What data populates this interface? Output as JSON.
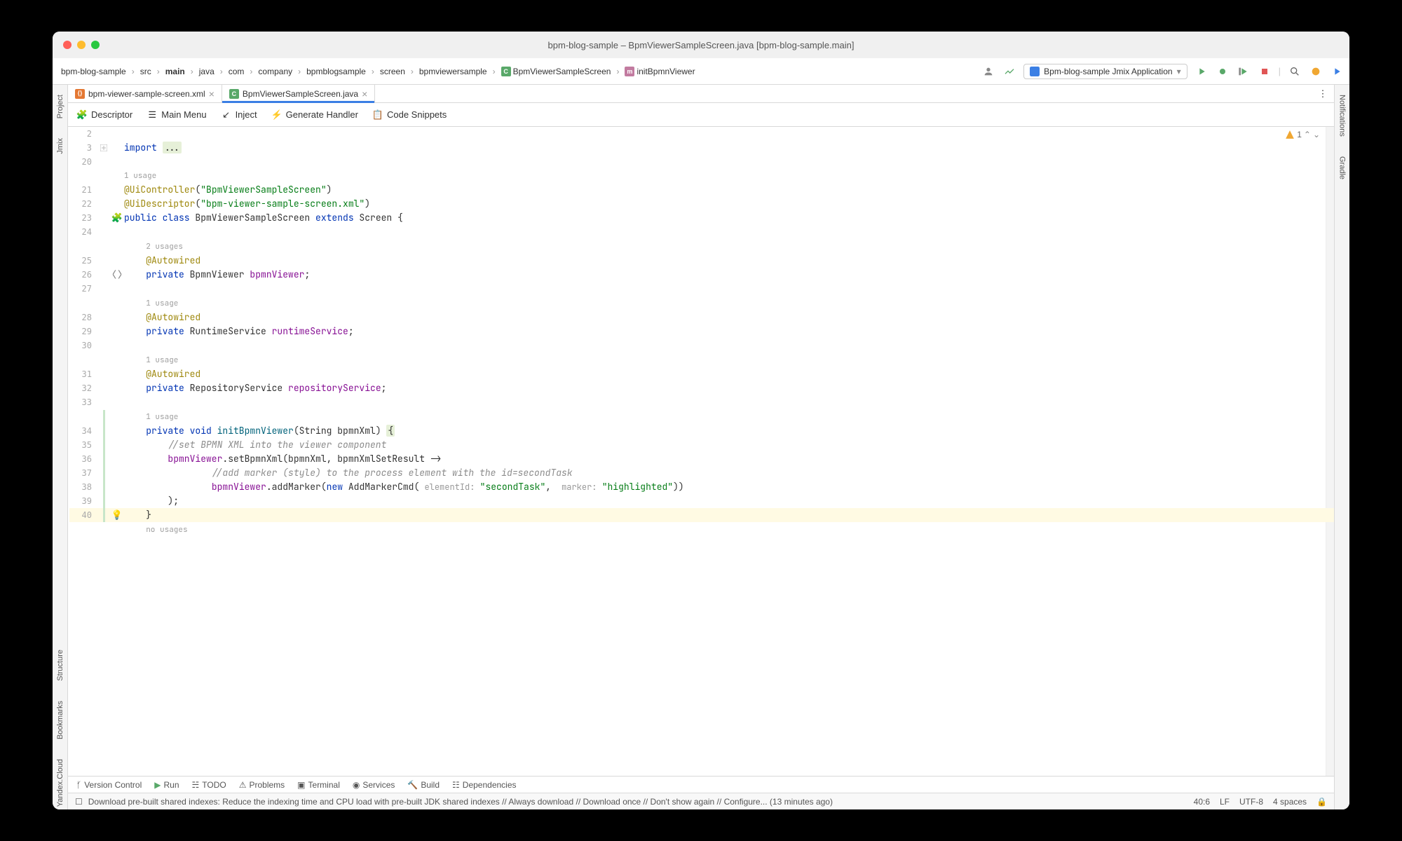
{
  "window_title": "bpm-blog-sample – BpmViewerSampleScreen.java [bpm-blog-sample.main]",
  "breadcrumb": {
    "items": [
      "bpm-blog-sample",
      "src",
      "main",
      "java",
      "com",
      "company",
      "bpmblogsample",
      "screen",
      "bpmviewersample",
      "BpmViewerSampleScreen",
      "initBpmnViewer"
    ]
  },
  "run_config": "Bpm-blog-sample Jmix Application",
  "tabs": [
    {
      "label": "bpm-viewer-sample-screen.xml",
      "kind": "xml"
    },
    {
      "label": "BpmViewerSampleScreen.java",
      "kind": "java"
    }
  ],
  "actions": {
    "descriptor": "Descriptor",
    "main_menu": "Main Menu",
    "inject": "Inject",
    "generate_handler": "Generate Handler",
    "code_snippets": "Code Snippets"
  },
  "left_tabs": {
    "project": "Project",
    "jmix": "Jmix",
    "structure": "Structure",
    "bookmarks": "Bookmarks",
    "yandex": "Yandex.Cloud"
  },
  "right_tabs": {
    "notifications": "Notifications",
    "gradle": "Gradle"
  },
  "warnings_count": "1",
  "code": {
    "l2": "",
    "l3_import": "import ",
    "l3_dots": "...",
    "l20": "",
    "u1": "1 usage",
    "u2": "2 usages",
    "no_usages": "no usages",
    "l21": {
      "ann": "@UiController",
      "p": "(",
      "s": "\"BpmViewerSampleScreen\"",
      "c": ")"
    },
    "l22": {
      "ann": "@UiDescriptor",
      "p": "(",
      "s": "\"bpm-viewer-sample-screen.xml\"",
      "c": ")"
    },
    "l23": {
      "a": "public class ",
      "b": "BpmViewerSampleScreen ",
      "c": "extends ",
      "d": "Screen {"
    },
    "l24": "",
    "l25": "@Autowired",
    "l26": {
      "a": "private ",
      "b": "BpmnViewer ",
      "c": "bpmnViewer",
      "d": ";"
    },
    "l27": "",
    "l28": "@Autowired",
    "l29": {
      "a": "private ",
      "b": "RuntimeService ",
      "c": "runtimeService",
      "d": ";"
    },
    "l30": "",
    "l31": "@Autowired",
    "l32": {
      "a": "private ",
      "b": "RepositoryService ",
      "c": "repositoryService",
      "d": ";"
    },
    "l33": "",
    "l34": {
      "a": "private void ",
      "b": "initBpmnViewer",
      "c": "(String bpmnXml) ",
      "d": "{"
    },
    "l35": "//set BPMN XML into the viewer component",
    "l36": {
      "a": "bpmnViewer",
      "b": ".setBpmnXml(bpmnXml, bpmnXmlSetResult ->"
    },
    "l37": "//add marker (style) to the process element with the id=secondTask",
    "l38": {
      "a": "bpmnViewer",
      "b": ".addMarker(",
      "c": "new ",
      "d": "AddMarkerCmd(",
      "h1": " elementId: ",
      "s1": "\"secondTask\"",
      "e": ", ",
      "h2": " marker: ",
      "s2": "\"highlighted\"",
      "f": "))"
    },
    "l39": ");",
    "l40": "}"
  },
  "bottom_tabs": {
    "version_control": "Version Control",
    "run": "Run",
    "todo": "TODO",
    "problems": "Problems",
    "terminal": "Terminal",
    "services": "Services",
    "build": "Build",
    "dependencies": "Dependencies"
  },
  "status": {
    "message": "Download pre-built shared indexes: Reduce the indexing time and CPU load with pre-built JDK shared indexes // Always download // Download once // Don't show again // Configure... (13 minutes ago)",
    "pos": "40:6",
    "line_sep": "LF",
    "encoding": "UTF-8",
    "indent": "4 spaces"
  }
}
